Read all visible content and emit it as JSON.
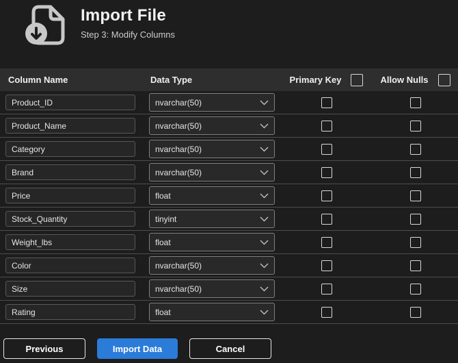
{
  "header": {
    "title": "Import File",
    "subtitle": "Step 3: Modify Columns"
  },
  "table": {
    "columns": {
      "name": "Column Name",
      "type": "Data Type",
      "primary_key": "Primary Key",
      "allow_nulls": "Allow Nulls"
    },
    "header_checkboxes": {
      "primary_key_all": false,
      "allow_nulls_all": false
    },
    "rows": [
      {
        "name": "Product_ID",
        "type": "nvarchar(50)",
        "primary_key": false,
        "allow_nulls": false
      },
      {
        "name": "Product_Name",
        "type": "nvarchar(50)",
        "primary_key": false,
        "allow_nulls": false
      },
      {
        "name": "Category",
        "type": "nvarchar(50)",
        "primary_key": false,
        "allow_nulls": false
      },
      {
        "name": "Brand",
        "type": "nvarchar(50)",
        "primary_key": false,
        "allow_nulls": false
      },
      {
        "name": "Price",
        "type": "float",
        "primary_key": false,
        "allow_nulls": false
      },
      {
        "name": "Stock_Quantity",
        "type": "tinyint",
        "primary_key": false,
        "allow_nulls": false
      },
      {
        "name": "Weight_lbs",
        "type": "float",
        "primary_key": false,
        "allow_nulls": false
      },
      {
        "name": "Color",
        "type": "nvarchar(50)",
        "primary_key": false,
        "allow_nulls": false
      },
      {
        "name": "Size",
        "type": "nvarchar(50)",
        "primary_key": false,
        "allow_nulls": false
      },
      {
        "name": "Rating",
        "type": "float",
        "primary_key": false,
        "allow_nulls": false
      }
    ]
  },
  "footer": {
    "previous": "Previous",
    "import": "Import Data",
    "cancel": "Cancel"
  },
  "colors": {
    "accent_blue": "#2b7bd9",
    "page_bg": "#1d1d1d",
    "header_band_bg": "#2e2e2e"
  }
}
